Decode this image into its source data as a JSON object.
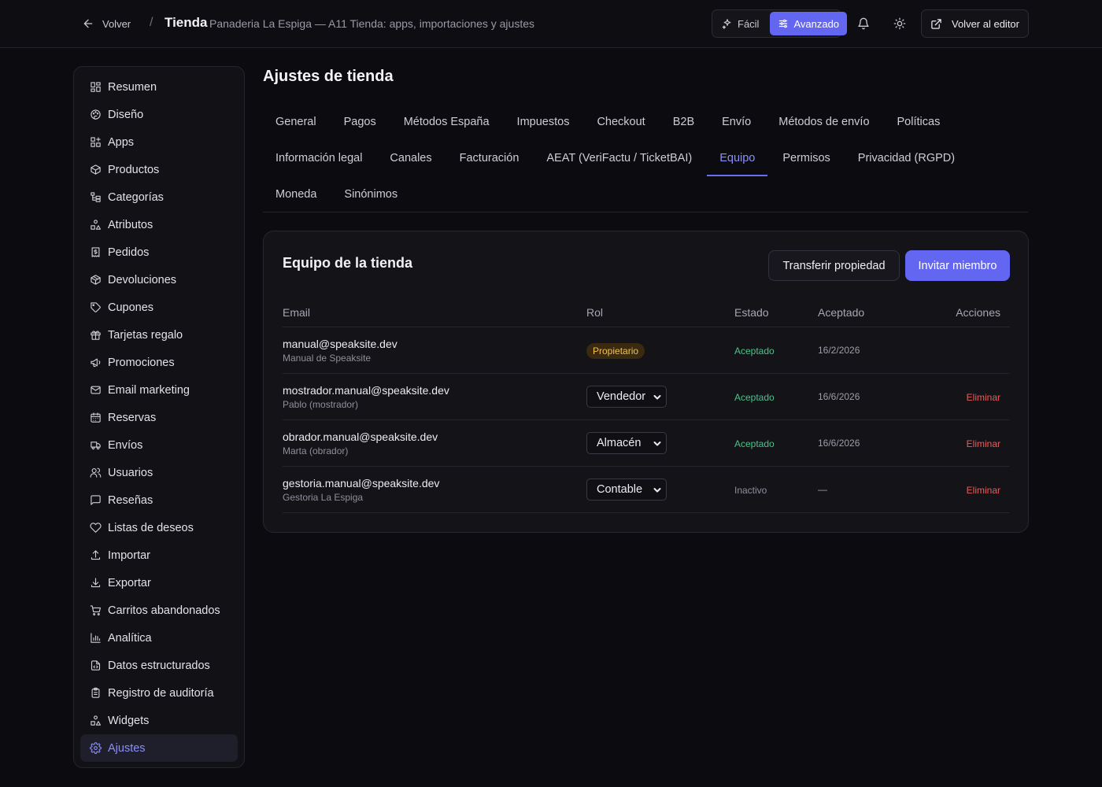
{
  "header": {
    "back_label": "Volver",
    "separator": "/",
    "title": "Tienda",
    "subtitle": "Panaderia La Espiga — A11 Tienda: apps, importaciones y ajustes",
    "mode_easy": "Fácil",
    "mode_advanced": "Avanzado",
    "back_to_editor": "Volver al editor"
  },
  "sidebar": {
    "items": [
      {
        "label": "Resumen",
        "icon": "dashboard-icon"
      },
      {
        "label": "Diseño",
        "icon": "palette-icon"
      },
      {
        "label": "Apps",
        "icon": "apps-icon"
      },
      {
        "label": "Productos",
        "icon": "box-icon"
      },
      {
        "label": "Categorías",
        "icon": "category-tree-icon"
      },
      {
        "label": "Atributos",
        "icon": "shapes-icon"
      },
      {
        "label": "Pedidos",
        "icon": "receipt-icon"
      },
      {
        "label": "Devoluciones",
        "icon": "box-return-icon"
      },
      {
        "label": "Cupones",
        "icon": "tag-icon"
      },
      {
        "label": "Tarjetas regalo",
        "icon": "gift-icon"
      },
      {
        "label": "Promociones",
        "icon": "megaphone-icon"
      },
      {
        "label": "Email marketing",
        "icon": "mail-icon"
      },
      {
        "label": "Reservas",
        "icon": "calendar-icon"
      },
      {
        "label": "Envíos",
        "icon": "truck-icon"
      },
      {
        "label": "Usuarios",
        "icon": "users-icon"
      },
      {
        "label": "Reseñas",
        "icon": "message-icon"
      },
      {
        "label": "Listas de deseos",
        "icon": "heart-icon"
      },
      {
        "label": "Importar",
        "icon": "upload-icon"
      },
      {
        "label": "Exportar",
        "icon": "download-icon"
      },
      {
        "label": "Carritos abandonados",
        "icon": "cart-icon"
      },
      {
        "label": "Analítica",
        "icon": "bar-chart-icon"
      },
      {
        "label": "Datos estructurados",
        "icon": "file-code-icon"
      },
      {
        "label": "Registro de auditoría",
        "icon": "clipboard-icon"
      },
      {
        "label": "Widgets",
        "icon": "widgets-icon"
      },
      {
        "label": "Ajustes",
        "icon": "gear-icon",
        "active": true
      }
    ]
  },
  "main": {
    "title": "Ajustes de tienda",
    "tabs_row1": [
      "General",
      "Pagos",
      "Métodos España",
      "Impuestos",
      "Checkout",
      "B2B",
      "Envío",
      "Métodos de envío",
      "Políticas"
    ],
    "tabs_row2": [
      "Información legal",
      "Canales",
      "Facturación",
      "AEAT (VeriFactu / TicketBAI)",
      "Equipo",
      "Permisos",
      "Privacidad (RGPD)"
    ],
    "tabs_row3": [
      "Moneda",
      "Sinónimos"
    ],
    "active_tab": "Equipo"
  },
  "team": {
    "title": "Equipo de la tienda",
    "transfer_label": "Transferir propiedad",
    "invite_label": "Invitar miembro",
    "columns": {
      "email": "Email",
      "role": "Rol",
      "status": "Estado",
      "accepted": "Aceptado",
      "actions": "Acciones"
    },
    "members": [
      {
        "email": "manual@speaksite.dev",
        "name": "Manual de Speaksite",
        "role": "Propietario",
        "role_type": "badge",
        "status": "Aceptado",
        "accepted": "16/2/2026",
        "action": ""
      },
      {
        "email": "mostrador.manual@speaksite.dev",
        "name": "Pablo (mostrador)",
        "role": "Vendedor",
        "role_type": "select",
        "status": "Aceptado",
        "accepted": "16/6/2026",
        "action": "Eliminar"
      },
      {
        "email": "obrador.manual@speaksite.dev",
        "name": "Marta (obrador)",
        "role": "Almacén",
        "role_type": "select",
        "status": "Aceptado",
        "accepted": "16/6/2026",
        "action": "Eliminar"
      },
      {
        "email": "gestoria.manual@speaksite.dev",
        "name": "Gestoria La Espiga",
        "role": "Contable",
        "role_type": "select",
        "status": "Inactivo",
        "accepted": "—",
        "action": "Eliminar"
      }
    ]
  },
  "colors": {
    "accent": "#6366f1",
    "accent_text": "#8b8ff8",
    "status_ok": "#4cc38a",
    "danger": "#f05a5a",
    "badge_bg": "#3a2a10",
    "badge_text": "#f1c04f"
  }
}
